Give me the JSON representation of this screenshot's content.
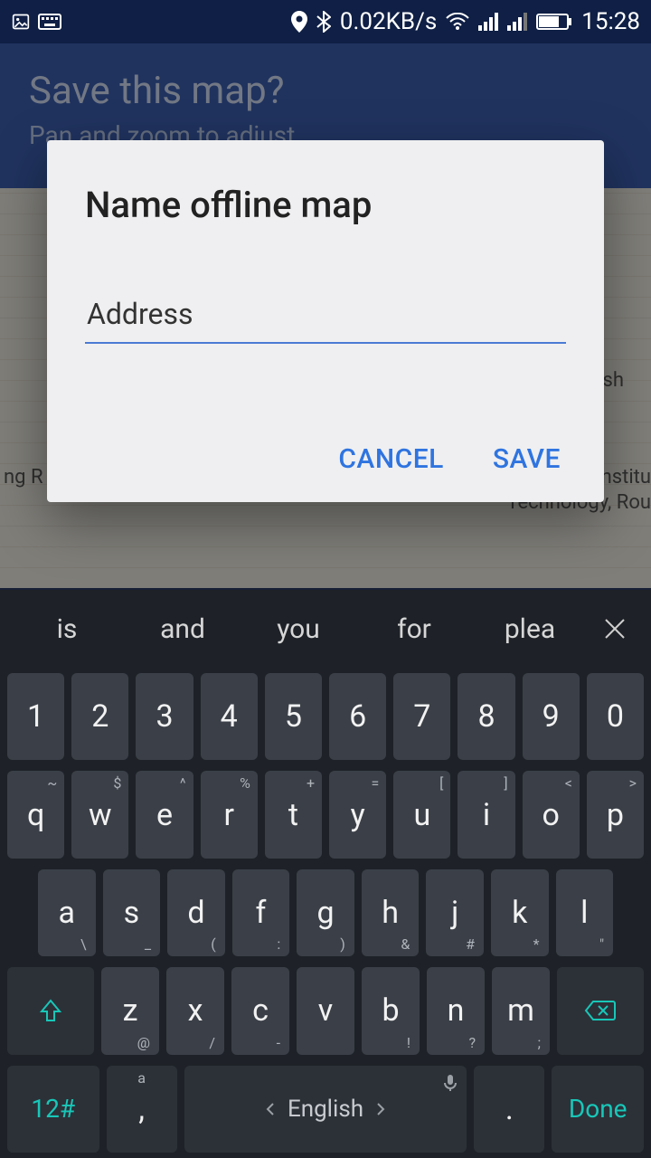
{
  "status": {
    "data_rate": "0.02KB/s",
    "time": "15:28"
  },
  "header": {
    "title": "Save this map?",
    "subtitle": "Pan and zoom to adjust"
  },
  "map_labels": {
    "a": "ng R",
    "b": "sh",
    "c": "Institu",
    "d": "Technology, Rou"
  },
  "dialog": {
    "title": "Name offline map",
    "input_value": "Address",
    "cancel": "CANCEL",
    "save": "SAVE"
  },
  "keyboard": {
    "suggestions": [
      "is",
      "and",
      "you",
      "for",
      "plea"
    ],
    "row_num": [
      "1",
      "2",
      "3",
      "4",
      "5",
      "6",
      "7",
      "8",
      "9",
      "0"
    ],
    "row_q": {
      "keys": [
        "q",
        "w",
        "e",
        "r",
        "t",
        "y",
        "u",
        "i",
        "o",
        "p"
      ],
      "alts": [
        "~",
        "$",
        "^",
        "%",
        "+",
        "=",
        "[",
        "]",
        "<",
        ">"
      ]
    },
    "row_a": {
      "keys": [
        "a",
        "s",
        "d",
        "f",
        "g",
        "h",
        "j",
        "k",
        "l"
      ],
      "alts": [
        "\\",
        "_",
        "(",
        ":",
        ")",
        "&",
        "#",
        "*",
        "\""
      ]
    },
    "row_z": {
      "keys": [
        "z",
        "x",
        "c",
        "v",
        "b",
        "n",
        "m"
      ],
      "alts": [
        "@",
        "/",
        "-",
        "",
        "!",
        "?",
        ";"
      ]
    },
    "bottom": {
      "symkey": "12#",
      "comma_main": ",",
      "comma_alt": "a",
      "space_label": "English",
      "period": ".",
      "done": "Done"
    }
  }
}
